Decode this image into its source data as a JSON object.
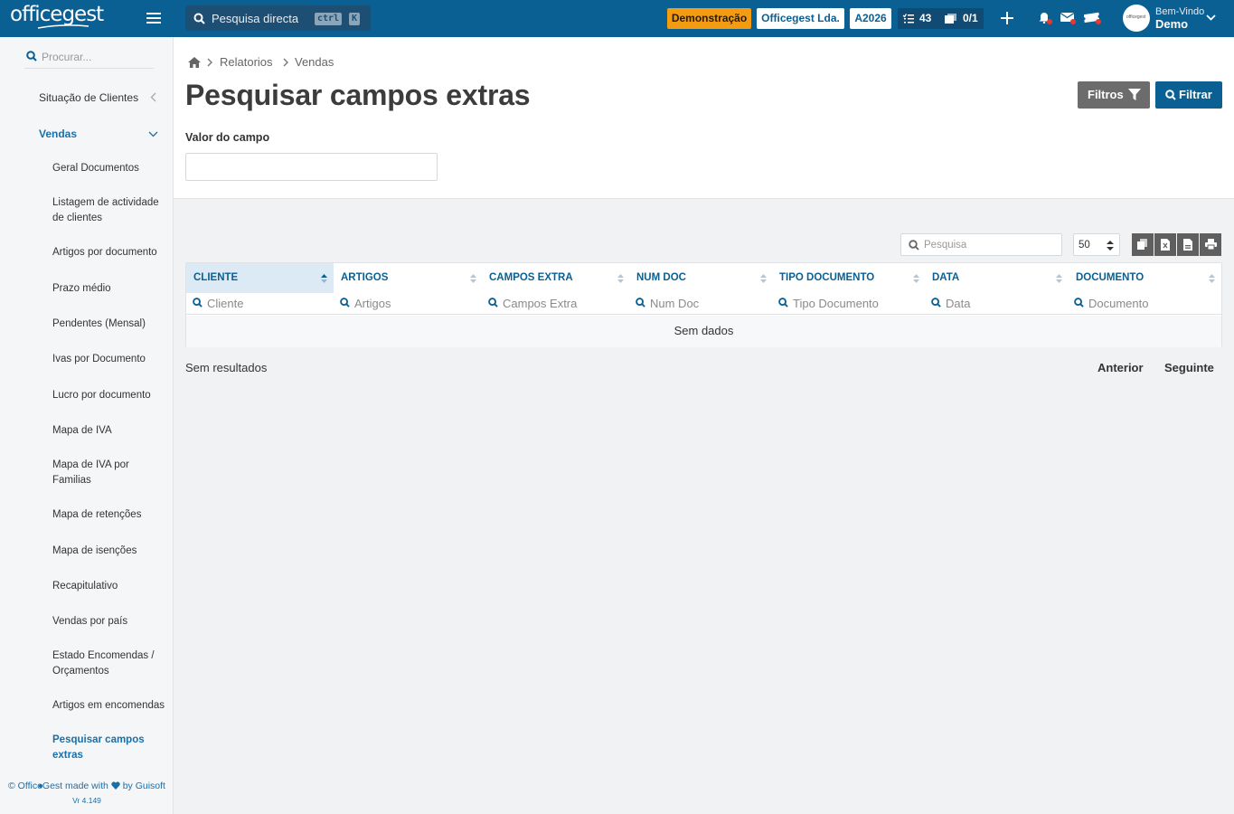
{
  "topbar": {
    "logo": "officegest",
    "search_label": "Pesquisa directa",
    "kbd_ctrl": "ctrl",
    "kbd_k": "K",
    "demo_badge": "Demonstração",
    "company": "Officegest Lda.",
    "year": "A2026",
    "tasks_count": "43",
    "docs_count": "0/1",
    "welcome": "Bem-Vindo",
    "user": "Demo",
    "colors": {
      "bar": "#0a5f93",
      "demo": "#f39c12"
    }
  },
  "sidebar": {
    "search_placeholder": "Procurar...",
    "top_items": [
      {
        "label": "Situação de Clientes"
      },
      {
        "label": "Vendas"
      }
    ],
    "sub_items": [
      {
        "label": "Geral Documentos"
      },
      {
        "label": "Listagem de actividade de clientes"
      },
      {
        "label": "Artigos por documento"
      },
      {
        "label": "Prazo médio"
      },
      {
        "label": "Pendentes (Mensal)"
      },
      {
        "label": "Ivas por Documento"
      },
      {
        "label": "Lucro por documento"
      },
      {
        "label": "Mapa de IVA"
      },
      {
        "label": "Mapa de IVA por Familias"
      },
      {
        "label": "Mapa de retenções"
      },
      {
        "label": "Mapa de isenções"
      },
      {
        "label": "Recapitulativo"
      },
      {
        "label": "Vendas por país"
      },
      {
        "label": "Estado Encomendas / Orçamentos"
      },
      {
        "label": "Artigos em encomendas"
      },
      {
        "label": "Pesquisar campos extras"
      }
    ],
    "footer_prefix": "© OfficeGest made with",
    "footer_suffix": "by Guisoft",
    "version": "Vr 4.149"
  },
  "breadcrumb": {
    "level1": "Relatorios",
    "level2": "Vendas"
  },
  "page": {
    "title": "Pesquisar campos extras",
    "filtros_label": "Filtros",
    "filtrar_label": "Filtrar",
    "field_label": "Valor do campo",
    "field_value": ""
  },
  "grid": {
    "search_placeholder": "Pesquisa",
    "page_size": "50",
    "columns": [
      {
        "label": "CLIENTE",
        "placeholder": "Cliente"
      },
      {
        "label": "ARTIGOS",
        "placeholder": "Artigos"
      },
      {
        "label": "CAMPOS EXTRA",
        "placeholder": "Campos Extra"
      },
      {
        "label": "NUM DOC",
        "placeholder": "Num Doc"
      },
      {
        "label": "TIPO DOCUMENTO",
        "placeholder": "Tipo Documento"
      },
      {
        "label": "DATA",
        "placeholder": "Data"
      },
      {
        "label": "DOCUMENTO",
        "placeholder": "Documento"
      }
    ],
    "empty_text": "Sem dados",
    "results_text": "Sem resultados",
    "prev_label": "Anterior",
    "next_label": "Seguinte"
  }
}
